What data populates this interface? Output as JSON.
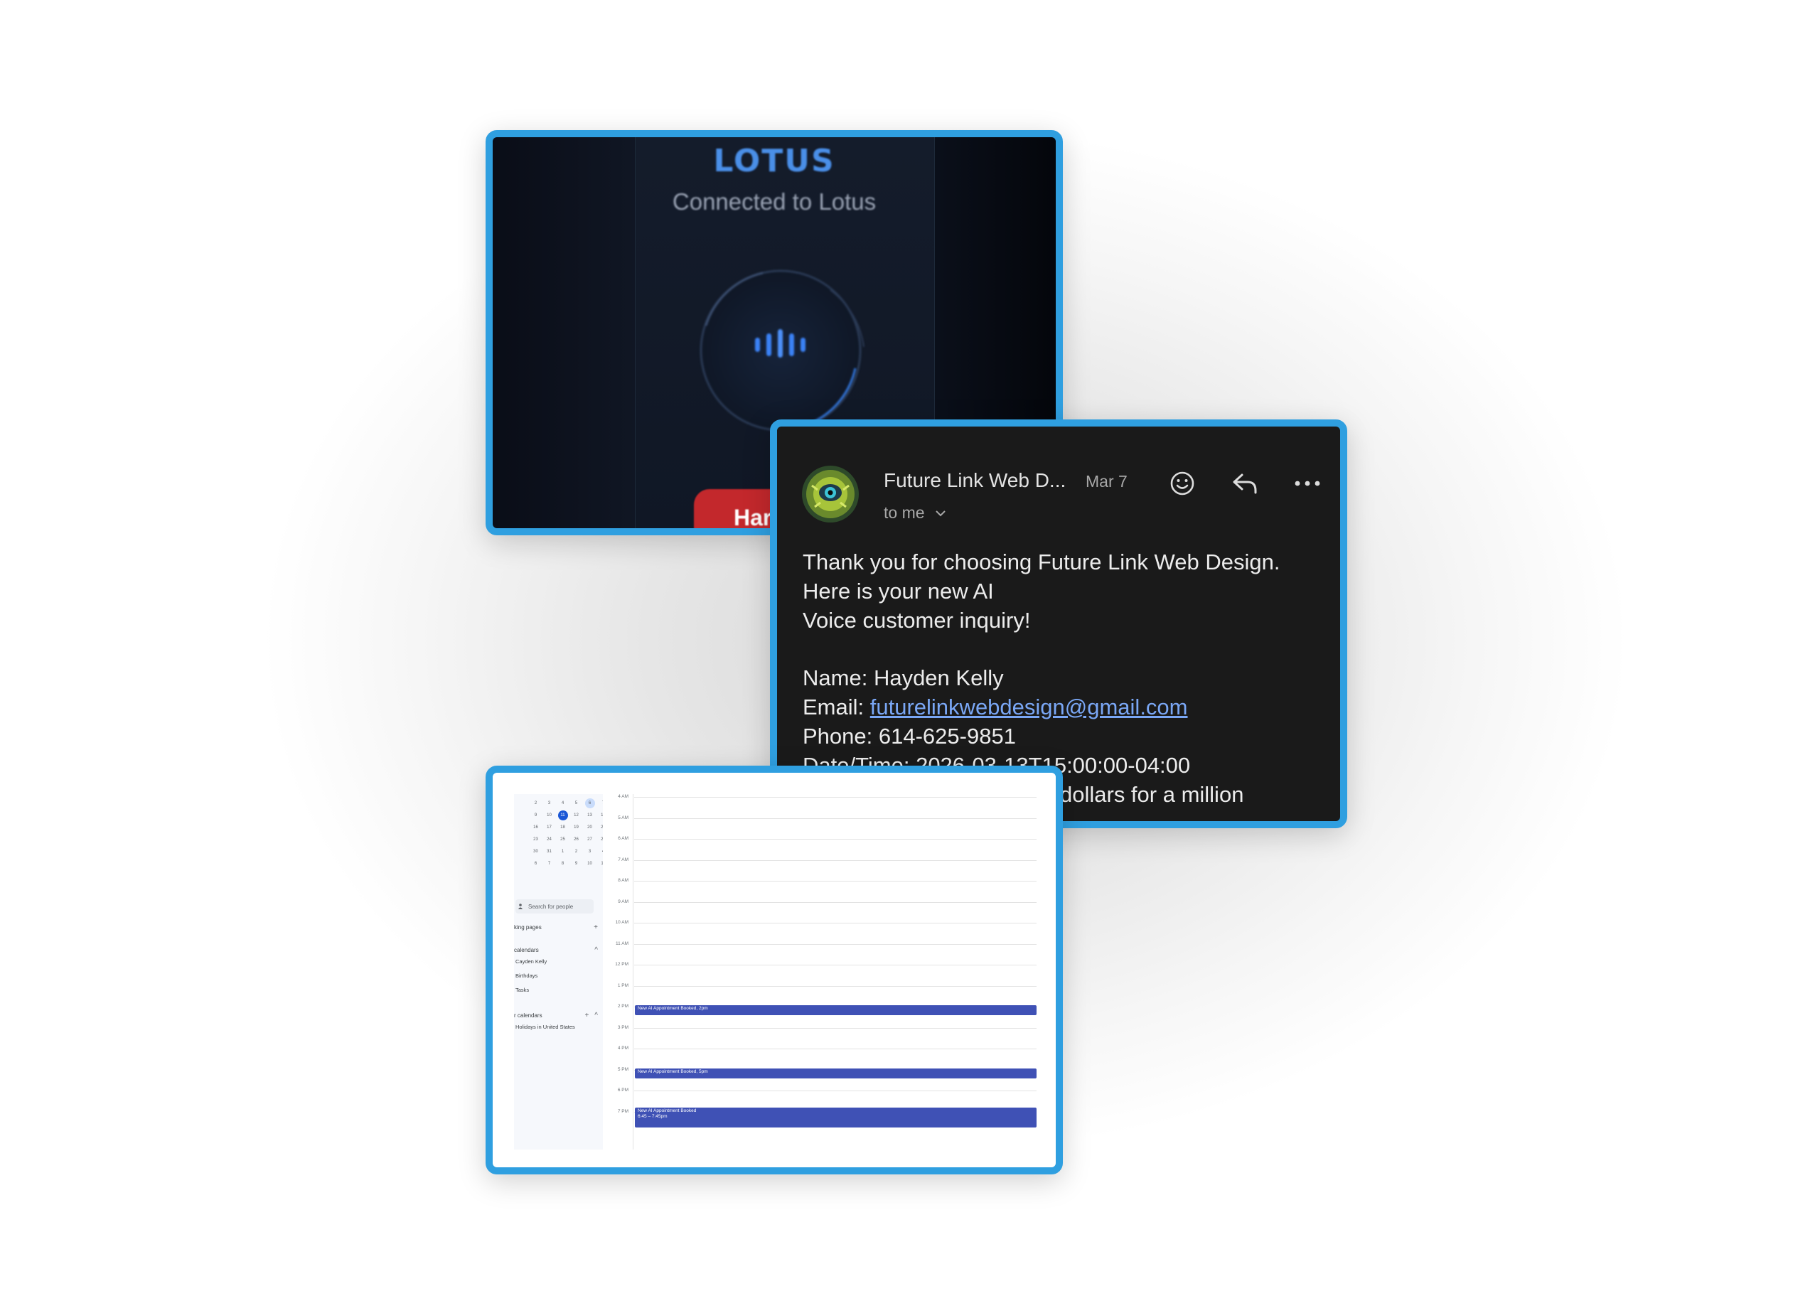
{
  "voice_app": {
    "brand": "LOTUS",
    "status": "Connected to Lotus",
    "hangup_label": "Har"
  },
  "email": {
    "sender": "Future Link Web D...",
    "date": "Mar 7",
    "recipient": "to me",
    "body": {
      "line1": "Thank you for choosing Future Link Web Design.",
      "line2": "Here is your new AI",
      "line3": "Voice customer inquiry!",
      "name_label": "Name:",
      "name_value": "Hayden Kelly",
      "email_label": "Email:",
      "email_value": "futurelinkwebdesign@gmail.com",
      "phone_label": "Phone:",
      "phone_value": "614-625-9851",
      "datetime_label": "Date/Time:",
      "datetime_value": "2026-03-13T15:00:00-04:00",
      "partial_line": "dollars for a million"
    },
    "colors": {
      "link": "#7aa7f5",
      "background": "#1a1a1a"
    }
  },
  "calendar": {
    "mini_month": [
      [
        "2",
        "3",
        "4",
        "5",
        "6",
        "7"
      ],
      [
        "9",
        "10",
        "11",
        "12",
        "13",
        "14"
      ],
      [
        "16",
        "17",
        "18",
        "19",
        "20",
        "21"
      ],
      [
        "23",
        "24",
        "25",
        "26",
        "27",
        "28"
      ],
      [
        "30",
        "31",
        "1",
        "2",
        "3",
        "4"
      ],
      [
        "6",
        "7",
        "8",
        "9",
        "10",
        "11"
      ]
    ],
    "people_search_placeholder": "Search for people",
    "booking_pages_label": "king pages",
    "my_calendars_label": "calendars",
    "my_calendars": [
      "Cayden Kelly",
      "Birthdays",
      "Tasks"
    ],
    "other_calendars_label": "r calendars",
    "other_calendars": [
      "Holidays in United States"
    ],
    "hours": [
      "4 AM",
      "5 AM",
      "6 AM",
      "7 AM",
      "8 AM",
      "9 AM",
      "10 AM",
      "11 AM",
      "12 PM",
      "1 PM",
      "2 PM",
      "3 PM",
      "4 PM",
      "5 PM",
      "6 PM",
      "7 PM"
    ],
    "events": [
      {
        "title": "New AI Appointment Booked, 2pm",
        "time": ""
      },
      {
        "title": "New AI Appointment Booked, 5pm",
        "time": ""
      },
      {
        "title": "New AI Appointment Booked",
        "time": "6:45 – 7:45pm"
      }
    ],
    "event_color": "#3f51b5"
  }
}
